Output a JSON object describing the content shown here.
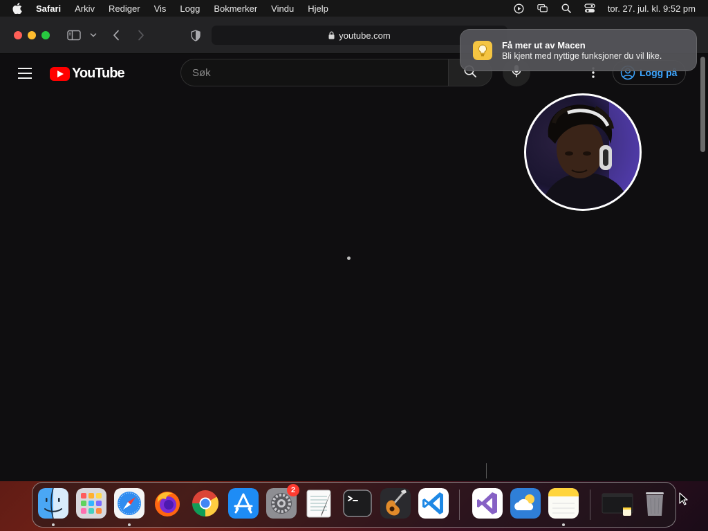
{
  "menubar": {
    "app_name": "Safari",
    "items": [
      "Arkiv",
      "Rediger",
      "Vis",
      "Logg",
      "Bokmerker",
      "Vindu",
      "Hjelp"
    ],
    "clock": "tor. 27. jul. kl. 9:52 pm",
    "status_icons": [
      "screen-record-icon",
      "window-switch-icon",
      "spotlight-icon",
      "control-center-icon"
    ]
  },
  "safari": {
    "address": "youtube.com"
  },
  "youtube": {
    "logo_text": "YouTube",
    "search_placeholder": "Søk",
    "signin_label": "Logg på"
  },
  "notification": {
    "title": "Få mer ut av Macen",
    "body": "Bli kjent med nyttige funksjoner du vil like."
  },
  "dock": {
    "apps": [
      {
        "name": "finder",
        "running": true
      },
      {
        "name": "launchpad",
        "running": false
      },
      {
        "name": "safari",
        "running": true
      },
      {
        "name": "firefox",
        "running": false
      },
      {
        "name": "chrome",
        "running": false
      },
      {
        "name": "app-store",
        "running": false
      },
      {
        "name": "system-settings",
        "running": false,
        "badge": "2"
      },
      {
        "name": "textedit",
        "running": false
      },
      {
        "name": "terminal",
        "running": false
      },
      {
        "name": "garageband",
        "running": false
      },
      {
        "name": "vscode",
        "running": false
      },
      {
        "name": "visual-studio",
        "running": false
      },
      {
        "name": "weather",
        "running": false
      },
      {
        "name": "notes",
        "running": true
      },
      {
        "name": "minimized-window",
        "running": false
      },
      {
        "name": "trash",
        "running": false
      }
    ]
  },
  "colors": {
    "youtube_red": "#ff0000",
    "link_blue": "#3ea6ff",
    "page_bg": "#0f0e10",
    "toolbar_bg": "#232325"
  }
}
